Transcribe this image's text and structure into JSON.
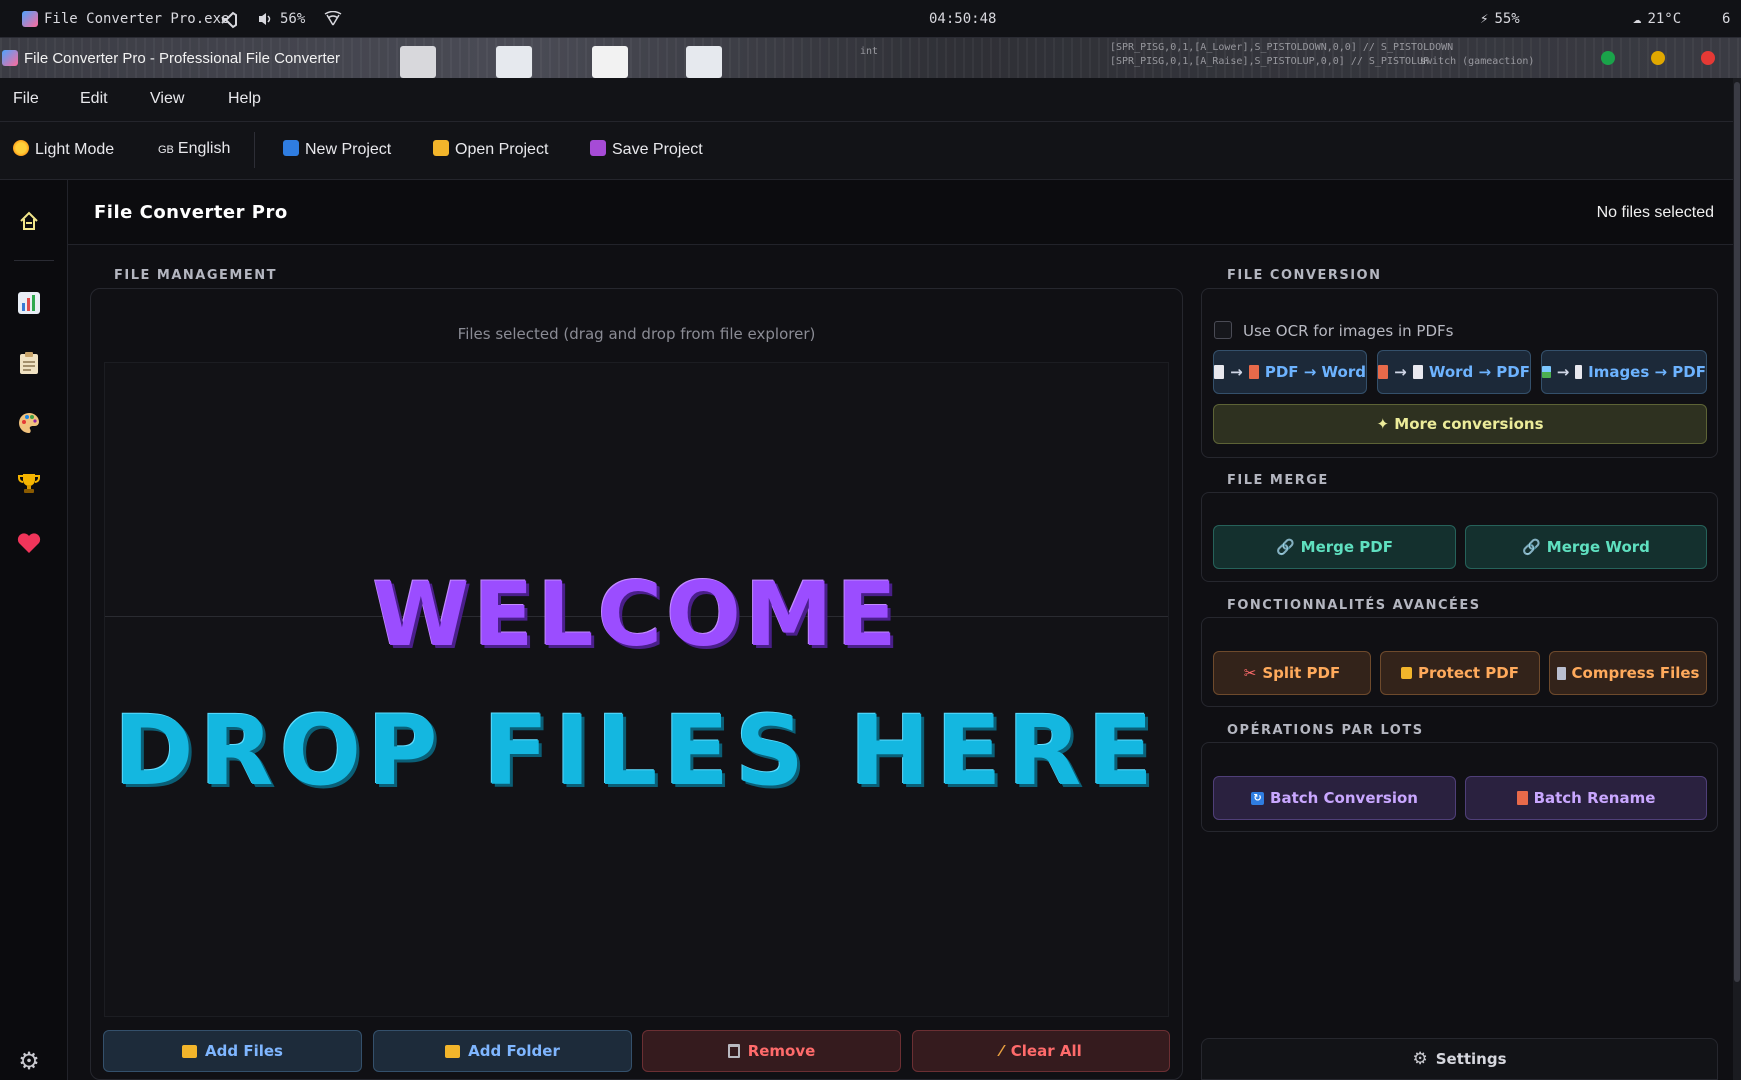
{
  "sysbar": {
    "app_name": "File Converter Pro.exe",
    "volume": "56%",
    "clock": "04:50:48",
    "battery": "55%",
    "weather": "21°C",
    "edge": "6"
  },
  "window": {
    "title": "File Converter Pro - Professional File Converter"
  },
  "menu": {
    "file": "File",
    "edit": "Edit",
    "view": "View",
    "help": "Help"
  },
  "toolbar": {
    "light_mode": "Light Mode",
    "language_flag": "GB",
    "language": "English",
    "new_project": "New Project",
    "open_project": "Open Project",
    "save_project": "Save Project"
  },
  "sidebar": {
    "home": "home-icon",
    "items": [
      "chart-icon",
      "clipboard-icon",
      "palette-icon",
      "trophy-icon",
      "heart-icon"
    ],
    "settings": "gear-icon"
  },
  "header": {
    "title": "File Converter Pro",
    "status": "No files selected"
  },
  "file_management": {
    "section": "FILE MANAGEMENT",
    "hint": "Files selected (drag and drop from file explorer)",
    "welcome": "WELCOME",
    "drop": "DROP FILES HERE",
    "add_files": "Add Files",
    "add_folder": "Add Folder",
    "remove": "Remove",
    "clear_all": "Clear All"
  },
  "conversion": {
    "section": "FILE CONVERSION",
    "ocr_label": "Use OCR for images in PDFs",
    "pdf_word": "PDF → Word",
    "word_pdf": "Word → PDF",
    "images_pdf": "Images → PDF",
    "arrow": "→",
    "more": "✦ More conversions"
  },
  "merge": {
    "section": "FILE MERGE",
    "merge_pdf": "Merge PDF",
    "merge_word": "Merge Word"
  },
  "advanced": {
    "section": "FONCTIONNALITÉS AVANCÉES",
    "split_pdf": "Split PDF",
    "protect_pdf": "Protect PDF",
    "compress": "Compress Files"
  },
  "batch": {
    "section": "OPÉRATIONS PAR LOTS",
    "batch_conversion": "Batch Conversion",
    "batch_rename": "Batch Rename"
  },
  "settings": {
    "label": "Settings"
  },
  "colors": {
    "welcome": "#9b4dff",
    "drop": "#14b7e0",
    "win_green": "#1aa34a",
    "win_yellow": "#e0a800",
    "win_red": "#e53935"
  }
}
